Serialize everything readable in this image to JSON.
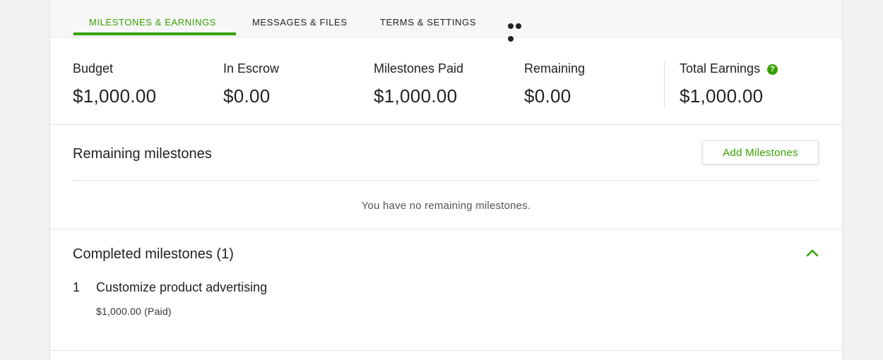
{
  "tabs": [
    {
      "label": "MILESTONES & EARNINGS",
      "active": true
    },
    {
      "label": "MESSAGES & FILES",
      "active": false
    },
    {
      "label": "TERMS & SETTINGS",
      "active": false
    }
  ],
  "more_icon": "more-horizontal-icon",
  "stats": [
    {
      "label": "Budget",
      "value": "$1,000.00"
    },
    {
      "label": "In Escrow",
      "value": "$0.00"
    },
    {
      "label": "Milestones Paid",
      "value": "$1,000.00"
    },
    {
      "label": "Remaining",
      "value": "$0.00"
    },
    {
      "label": "Total Earnings",
      "value": "$1,000.00",
      "help": "?"
    }
  ],
  "remaining": {
    "title": "Remaining milestones",
    "add_button": "Add Milestones",
    "empty_message": "You have no remaining milestones."
  },
  "completed": {
    "title": "Completed milestones (1)",
    "items": [
      {
        "index": "1",
        "title": "Customize product advertising",
        "amount": "$1,000.00 (Paid)"
      }
    ]
  },
  "colors": {
    "accent": "#37a000",
    "background": "#f2f2f2",
    "card": "#ffffff"
  }
}
